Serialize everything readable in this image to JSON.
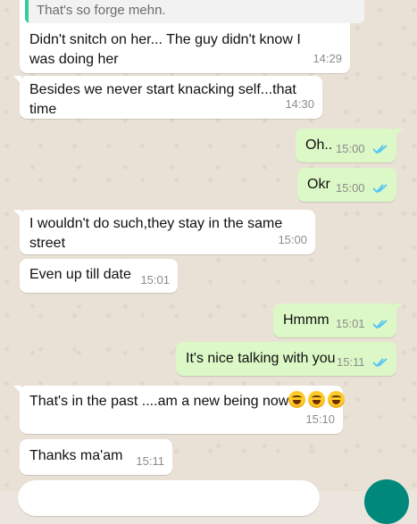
{
  "messages": [
    {
      "quote": "That's so forge mehn.",
      "text": "Didn't snitch on her... The guy didn't know I was doing her",
      "time": "14:29"
    },
    {
      "text": "Besides we never start knacking self...that time",
      "time": "14:30"
    },
    {
      "text": "Oh..",
      "time": "15:00"
    },
    {
      "text": "Okr",
      "time": "15:00"
    },
    {
      "text": "I wouldn't do such,they stay in the same street",
      "time": "15:00"
    },
    {
      "text": "Even up till date",
      "time": "15:01"
    },
    {
      "text": "Hmmm",
      "time": "15:01"
    },
    {
      "text": "It's nice talking with you",
      "time": "15:11"
    },
    {
      "text": "That's in the past ....am a new being now",
      "emoji": "rolling-on-floor-laughing",
      "emoji_count": 3,
      "time": "15:10"
    },
    {
      "text": "Thanks ma'am",
      "time": "15:11"
    }
  ],
  "colors": {
    "incoming": "#ffffff",
    "outgoing": "#dcf8c6",
    "read_ticks": "#4fc3f7",
    "quote_bar": "#35cd96",
    "send_button": "#00897b",
    "timestamp": "#8c8c8c"
  }
}
